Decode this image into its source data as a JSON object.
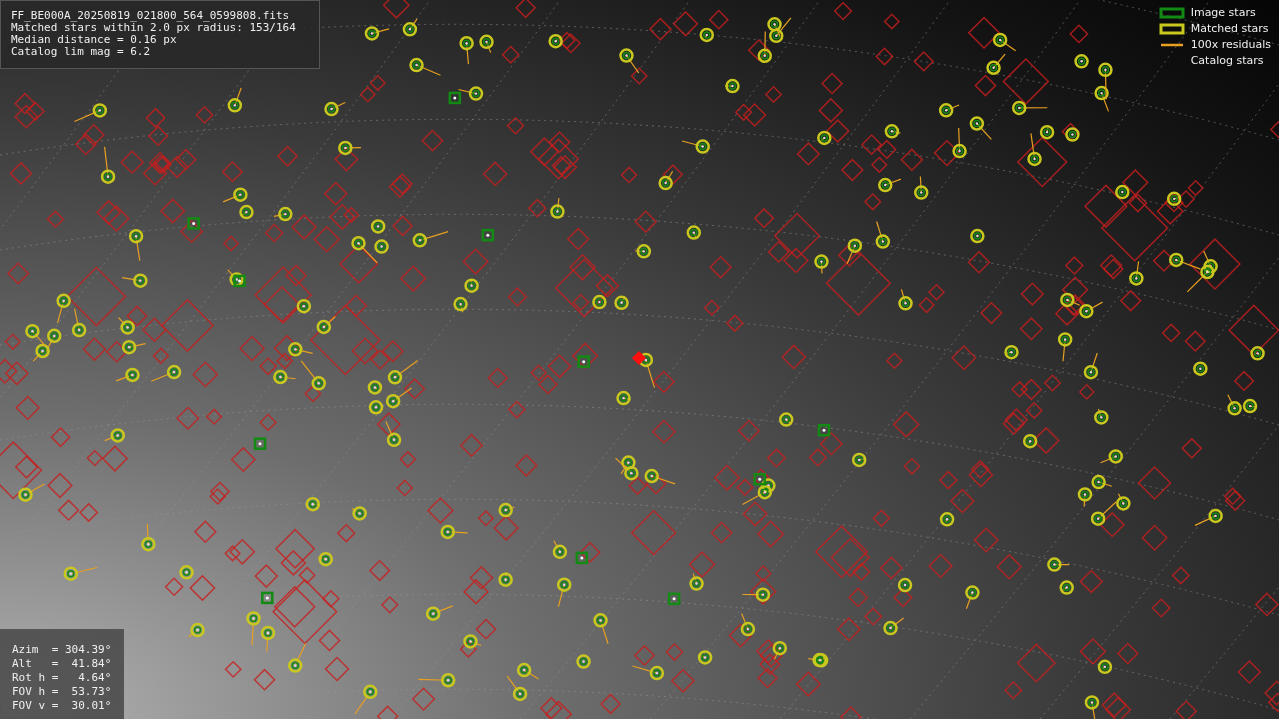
{
  "info": {
    "lines": [
      "FF_BE000A_20250819_021800_564_0599808.fits",
      "Matched stars within 2.0 px radius: 153/164",
      "Median distance = 0.16 px",
      "Catalog lim mag = 6.2"
    ]
  },
  "pointing": {
    "lines": [
      "Azim  = 304.39°",
      "Alt   =  41.84°",
      "Rot h =   4.64°",
      "FOV h =  53.73°",
      "FOV v =  30.01°"
    ]
  },
  "legend": [
    {
      "label": "Image stars",
      "kind": "box",
      "color": "#138a13"
    },
    {
      "label": "Matched stars",
      "kind": "box",
      "color": "#c8c81e"
    },
    {
      "label": "100x residuals",
      "kind": "line",
      "color": "#e8a020"
    },
    {
      "label": "Catalog stars",
      "kind": "none"
    }
  ]
}
